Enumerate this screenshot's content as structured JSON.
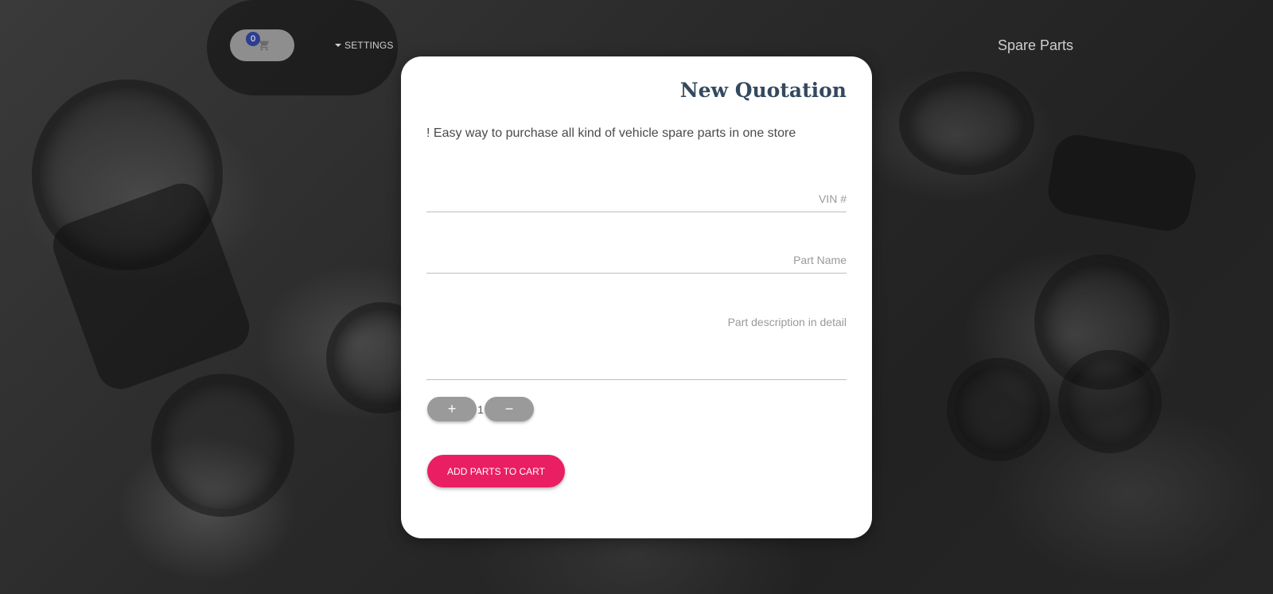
{
  "header": {
    "cart_count": "0",
    "settings_label": "SETTINGS",
    "brand": "Spare Parts"
  },
  "card": {
    "title": "New Quotation",
    "subtitle": "! Easy way to purchase all kind of vehicle spare parts in one store",
    "vin_placeholder": "# VIN",
    "part_name_placeholder": "Part Name",
    "description_placeholder": "Part description in detail",
    "quantity": "1",
    "plus_label": "+",
    "minus_label": "−",
    "add_button_label": "ADD PARTS TO CART"
  },
  "colors": {
    "accent": "#e91e63",
    "badge": "#2c3e8f",
    "title": "#34495e"
  }
}
